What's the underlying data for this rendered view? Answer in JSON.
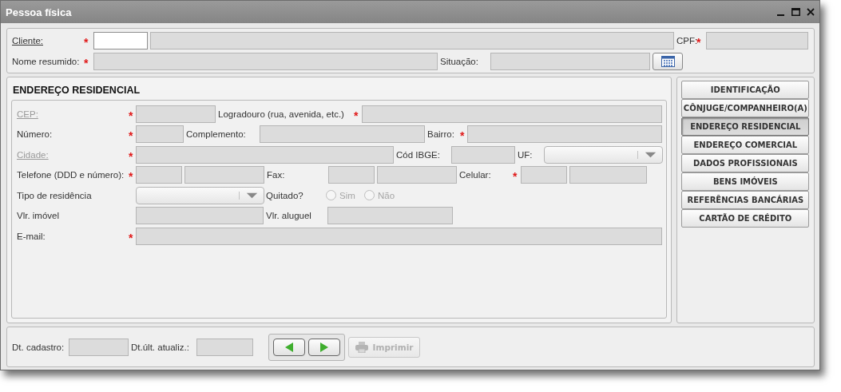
{
  "window": {
    "title": "Pessoa física"
  },
  "header": {
    "rows": [
      {
        "items": [
          {
            "kind": "label",
            "text": "Cliente:",
            "underlined": true
          },
          {
            "kind": "required",
            "text": "*"
          },
          {
            "kind": "field",
            "editable": true
          },
          {
            "kind": "field",
            "editable": false
          },
          {
            "kind": "label",
            "text": "CPF:"
          },
          {
            "kind": "required",
            "text": "*"
          },
          {
            "kind": "field",
            "editable": false
          }
        ]
      },
      {
        "items": [
          {
            "kind": "label",
            "text": "Nome resumido:"
          },
          {
            "kind": "required",
            "text": "*"
          },
          {
            "kind": "field",
            "editable": false
          },
          {
            "kind": "label",
            "text": "Situação:"
          },
          {
            "kind": "field",
            "editable": false
          },
          {
            "kind": "calendar"
          }
        ]
      }
    ]
  },
  "section": {
    "title": "ENDEREÇO RESIDENCIAL",
    "rows": [
      {
        "items": [
          {
            "kind": "label",
            "text": "CEP:",
            "underlined": true,
            "disabled": true
          },
          {
            "kind": "required",
            "text": "*"
          },
          {
            "kind": "field",
            "editable": false
          },
          {
            "kind": "label",
            "text": "Logradouro (rua, avenida, etc.)"
          },
          {
            "kind": "required",
            "text": "*"
          },
          {
            "kind": "field",
            "editable": false
          }
        ]
      },
      {
        "items": [
          {
            "kind": "label",
            "text": "Número:"
          },
          {
            "kind": "required",
            "text": "*"
          },
          {
            "kind": "field",
            "editable": false
          },
          {
            "kind": "label",
            "text": "Complemento:"
          },
          {
            "kind": "field",
            "editable": false
          },
          {
            "kind": "label",
            "text": "Bairro:"
          },
          {
            "kind": "required",
            "text": "*"
          },
          {
            "kind": "field",
            "editable": false
          }
        ]
      },
      {
        "items": [
          {
            "kind": "label",
            "text": "Cidade:",
            "underlined": true,
            "disabled": true
          },
          {
            "kind": "required",
            "text": "*"
          },
          {
            "kind": "field",
            "editable": false
          },
          {
            "kind": "label",
            "text": "Cód IBGE:"
          },
          {
            "kind": "field",
            "editable": false
          },
          {
            "kind": "label",
            "text": "UF:"
          },
          {
            "kind": "select"
          }
        ]
      },
      {
        "items": [
          {
            "kind": "label",
            "text": "Telefone (DDD e número):"
          },
          {
            "kind": "required",
            "text": "*"
          },
          {
            "kind": "field",
            "editable": false
          },
          {
            "kind": "field",
            "editable": false
          },
          {
            "kind": "label",
            "text": "Fax:"
          },
          {
            "kind": "field",
            "editable": false
          },
          {
            "kind": "field",
            "editable": false
          },
          {
            "kind": "label",
            "text": "Celular:"
          },
          {
            "kind": "required",
            "text": "*"
          },
          {
            "kind": "field",
            "editable": false
          },
          {
            "kind": "field",
            "editable": false
          }
        ]
      },
      {
        "items": [
          {
            "kind": "label",
            "text": "Tipo de residência"
          },
          {
            "kind": "select"
          },
          {
            "kind": "label",
            "text": "Quitado?"
          },
          {
            "kind": "radio",
            "label": "Sim",
            "selected": false,
            "disabled": true
          },
          {
            "kind": "radio",
            "label": "Não",
            "selected": false,
            "disabled": true
          }
        ]
      },
      {
        "items": [
          {
            "kind": "label",
            "text": "Vlr. imóvel"
          },
          {
            "kind": "field",
            "editable": false
          },
          {
            "kind": "label",
            "text": "Vlr. aluguel"
          },
          {
            "kind": "field",
            "editable": false
          }
        ]
      },
      {
        "items": [
          {
            "kind": "label",
            "text": "E-mail:"
          },
          {
            "kind": "required",
            "text": "*"
          },
          {
            "kind": "field",
            "editable": false
          }
        ]
      }
    ]
  },
  "nav": {
    "items": [
      {
        "label": "IDENTIFICAÇÃO",
        "selected": false
      },
      {
        "label": "CÔNJUGE/COMPANHEIRO(A)",
        "selected": false
      },
      {
        "label": "ENDEREÇO RESIDENCIAL",
        "selected": true
      },
      {
        "label": "ENDEREÇO COMERCIAL",
        "selected": false
      },
      {
        "label": "DADOS PROFISSIONAIS",
        "selected": false
      },
      {
        "label": "BENS IMÓVEIS",
        "selected": false
      },
      {
        "label": "REFERÊNCIAS BANCÁRIAS",
        "selected": false
      },
      {
        "label": "CARTÃO DE CRÉDITO",
        "selected": false
      }
    ]
  },
  "footer": {
    "items": [
      {
        "kind": "label",
        "text": "Dt. cadastro:"
      },
      {
        "kind": "field",
        "editable": false
      },
      {
        "kind": "label",
        "text": "Dt.últ. atualiz.:"
      },
      {
        "kind": "field",
        "editable": false
      }
    ],
    "print_button": {
      "label": "Imprimir",
      "disabled": true
    }
  }
}
